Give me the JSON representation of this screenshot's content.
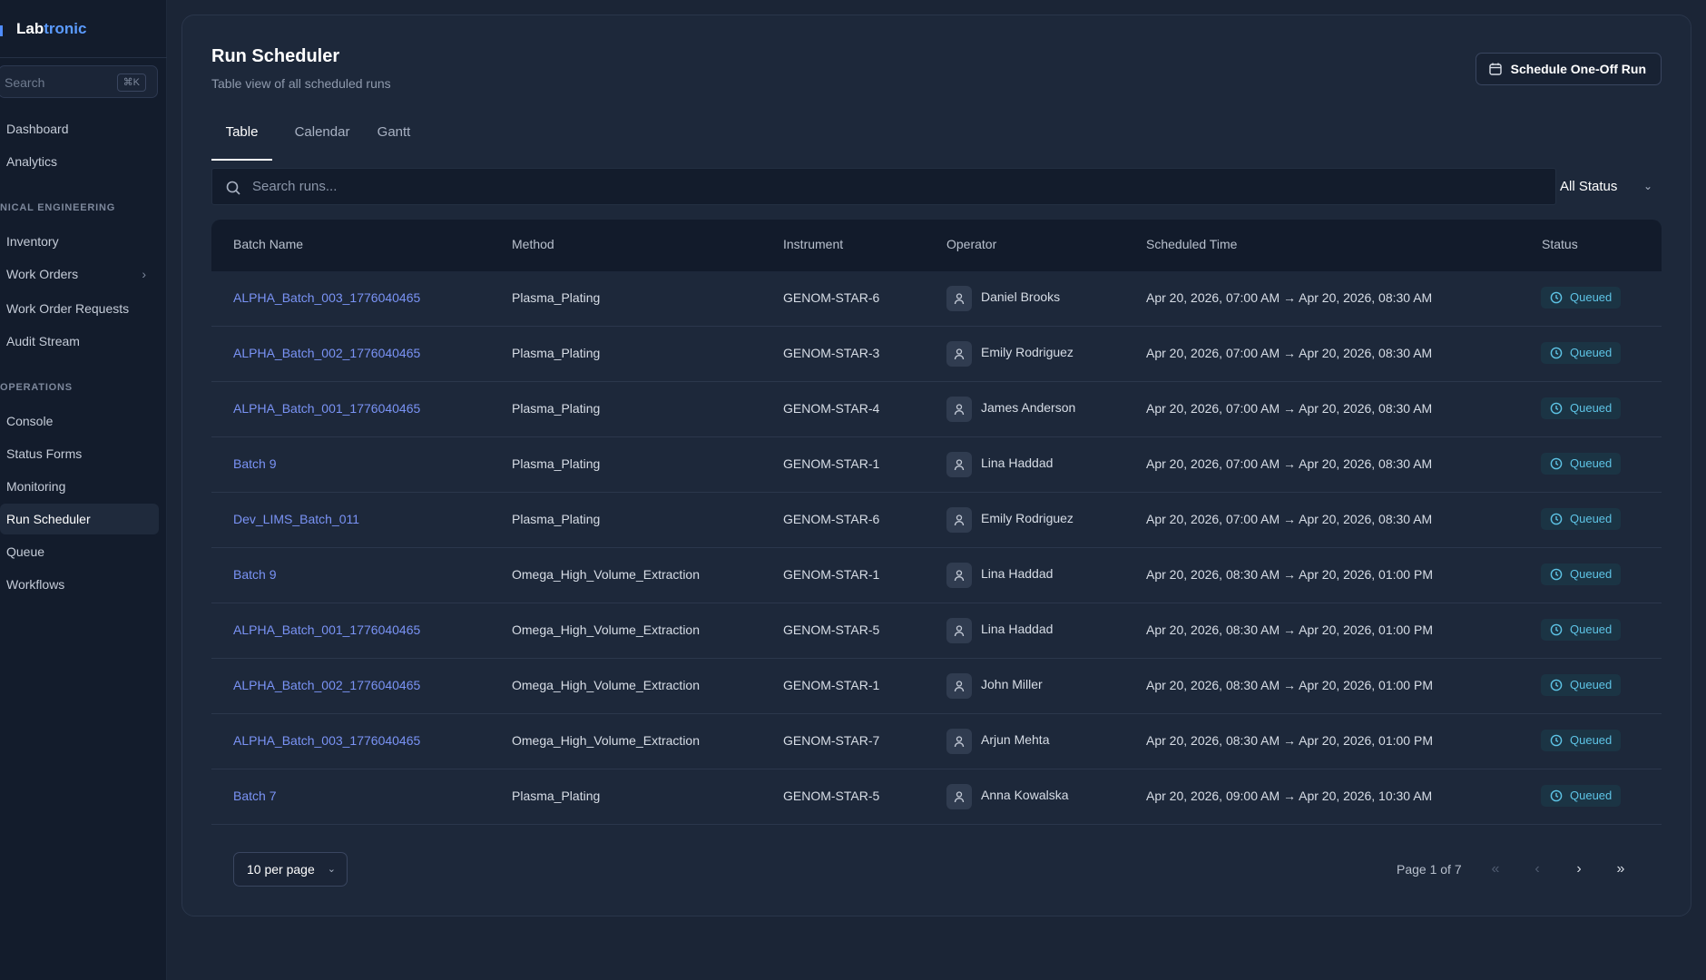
{
  "brand": {
    "prefix": "Lab",
    "accent": "tronic",
    "accent_color": "#5b9bff"
  },
  "sidebar": {
    "search_placeholder": "Search",
    "search_shortcut": "⌘K",
    "items_top": [
      {
        "label": "Dashboard"
      },
      {
        "label": "Analytics"
      }
    ],
    "section1": "NICAL ENGINEERING",
    "items_mid": [
      {
        "label": "Inventory"
      },
      {
        "label": "Work Orders"
      },
      {
        "label": "Work Order Requests"
      },
      {
        "label": "Audit Stream"
      }
    ],
    "section2": "OPERATIONS",
    "items_ops": [
      {
        "label": "Console"
      },
      {
        "label": "Status Forms"
      },
      {
        "label": "Monitoring"
      },
      {
        "label": "Run Scheduler"
      },
      {
        "label": "Queue"
      },
      {
        "label": "Workflows"
      }
    ]
  },
  "header": {
    "title": "Run Scheduler",
    "subtitle": "Table view of all scheduled runs",
    "schedule_button": "Schedule One-Off Run"
  },
  "tabs": [
    {
      "label": "Table"
    },
    {
      "label": "Calendar"
    },
    {
      "label": "Gantt"
    }
  ],
  "search": {
    "placeholder": "Search runs..."
  },
  "status_filter": "All Status",
  "table": {
    "columns": [
      "Batch Name",
      "Method",
      "Instrument",
      "Operator",
      "Scheduled Time",
      "Status"
    ],
    "rows": [
      {
        "batch": "ALPHA_Batch_003_1776040465",
        "method": "Plasma_Plating",
        "instrument": "GENOM-STAR-6",
        "operator": "Daniel Brooks",
        "time": "Apr 20, 2026, 07:00 AM → Apr 20, 2026, 08:30 AM",
        "status": "Queued"
      },
      {
        "batch": "ALPHA_Batch_002_1776040465",
        "method": "Plasma_Plating",
        "instrument": "GENOM-STAR-3",
        "operator": "Emily Rodriguez",
        "time": "Apr 20, 2026, 07:00 AM → Apr 20, 2026, 08:30 AM",
        "status": "Queued"
      },
      {
        "batch": "ALPHA_Batch_001_1776040465",
        "method": "Plasma_Plating",
        "instrument": "GENOM-STAR-4",
        "operator": "James Anderson",
        "time": "Apr 20, 2026, 07:00 AM → Apr 20, 2026, 08:30 AM",
        "status": "Queued"
      },
      {
        "batch": "Batch 9",
        "method": "Plasma_Plating",
        "instrument": "GENOM-STAR-1",
        "operator": "Lina Haddad",
        "time": "Apr 20, 2026, 07:00 AM → Apr 20, 2026, 08:30 AM",
        "status": "Queued"
      },
      {
        "batch": "Dev_LIMS_Batch_011",
        "method": "Plasma_Plating",
        "instrument": "GENOM-STAR-6",
        "operator": "Emily Rodriguez",
        "time": "Apr 20, 2026, 07:00 AM → Apr 20, 2026, 08:30 AM",
        "status": "Queued"
      },
      {
        "batch": "Batch 9",
        "method": "Omega_High_Volume_Extraction",
        "instrument": "GENOM-STAR-1",
        "operator": "Lina Haddad",
        "time": "Apr 20, 2026, 08:30 AM → Apr 20, 2026, 01:00 PM",
        "status": "Queued"
      },
      {
        "batch": "ALPHA_Batch_001_1776040465",
        "method": "Omega_High_Volume_Extraction",
        "instrument": "GENOM-STAR-5",
        "operator": "Lina Haddad",
        "time": "Apr 20, 2026, 08:30 AM → Apr 20, 2026, 01:00 PM",
        "status": "Queued"
      },
      {
        "batch": "ALPHA_Batch_002_1776040465",
        "method": "Omega_High_Volume_Extraction",
        "instrument": "GENOM-STAR-1",
        "operator": "John Miller",
        "time": "Apr 20, 2026, 08:30 AM → Apr 20, 2026, 01:00 PM",
        "status": "Queued"
      },
      {
        "batch": "ALPHA_Batch_003_1776040465",
        "method": "Omega_High_Volume_Extraction",
        "instrument": "GENOM-STAR-7",
        "operator": "Arjun Mehta",
        "time": "Apr 20, 2026, 08:30 AM → Apr 20, 2026, 01:00 PM",
        "status": "Queued"
      },
      {
        "batch": "Batch 7",
        "method": "Plasma_Plating",
        "instrument": "GENOM-STAR-5",
        "operator": "Anna Kowalska",
        "time": "Apr 20, 2026, 09:00 AM → Apr 20, 2026, 10:30 AM",
        "status": "Queued"
      }
    ]
  },
  "pagination": {
    "per_page": "10 per page",
    "page_info": "Page 1 of 7",
    "first": "«",
    "prev": "‹",
    "next": "›",
    "last": "»"
  },
  "colors": {
    "link": "#7a93f5",
    "queued_text": "#5ec4e6",
    "queued_bg": "#1b3444"
  }
}
